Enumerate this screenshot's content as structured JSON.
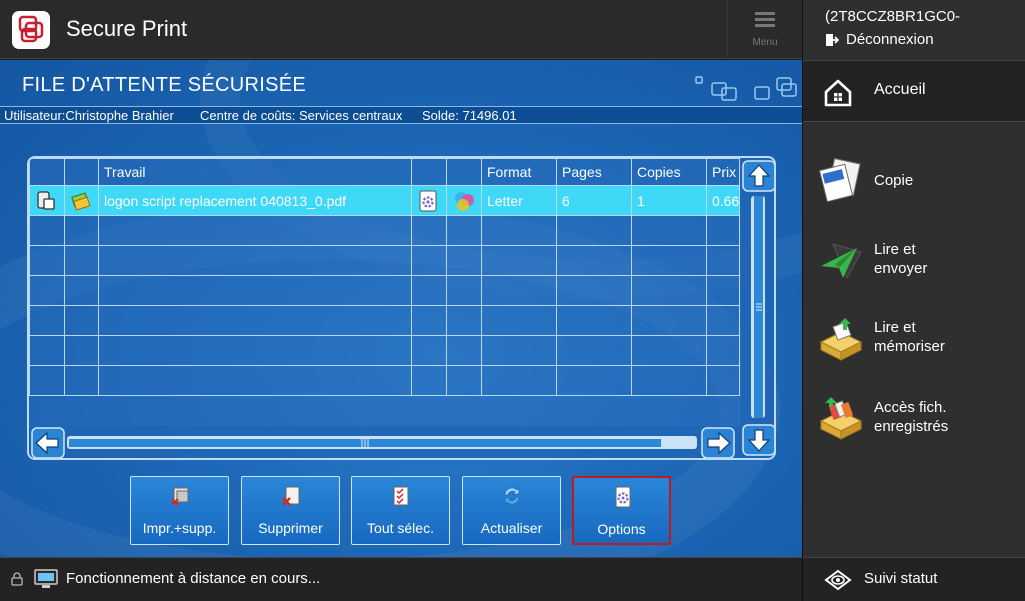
{
  "app": {
    "title": "Secure Print",
    "menu_label": "Menu"
  },
  "device": {
    "id": "(2T8CCZ8BR1GC0-",
    "logout_label": "Déconnexion"
  },
  "sidebar": {
    "home_label": "Accueil",
    "items": [
      {
        "label": "Copie",
        "icon": "copy-icon"
      },
      {
        "label": "Lire et\nenvoyer",
        "icon": "scan-send-icon"
      },
      {
        "label": "Lire et\nmémoriser",
        "icon": "scan-store-icon"
      },
      {
        "label": "Accès fich.\nenregistrés",
        "icon": "stored-files-icon"
      }
    ],
    "status_label": "Suivi statut"
  },
  "queue": {
    "title": "FILE D'ATTENTE SÉCURISÉE",
    "user": "Utilisateur:Christophe Brahier",
    "cost_center": "Centre de coûts: Services centraux",
    "balance": "Solde: 71496.01"
  },
  "table": {
    "columns": [
      "",
      "",
      "Travail",
      "",
      "",
      "Format",
      "Pages",
      "Copies",
      "Prix"
    ],
    "rows": [
      {
        "job": "logon script replacement 040813_0.pdf",
        "format": "Letter",
        "pages": "6",
        "copies": "1",
        "price": "0.66"
      }
    ],
    "empty_rows": 6
  },
  "actions": {
    "print_delete": "Impr.+supp.",
    "delete": "Supprimer",
    "select_all": "Tout sélec.",
    "refresh": "Actualiser",
    "options": "Options"
  },
  "footer": {
    "status": "Fonctionnement à distance en cours..."
  },
  "colors": {
    "accent_blue": "#1d68b7",
    "selected_row": "#3fd8f7",
    "highlight_border": "#c21a1a"
  }
}
